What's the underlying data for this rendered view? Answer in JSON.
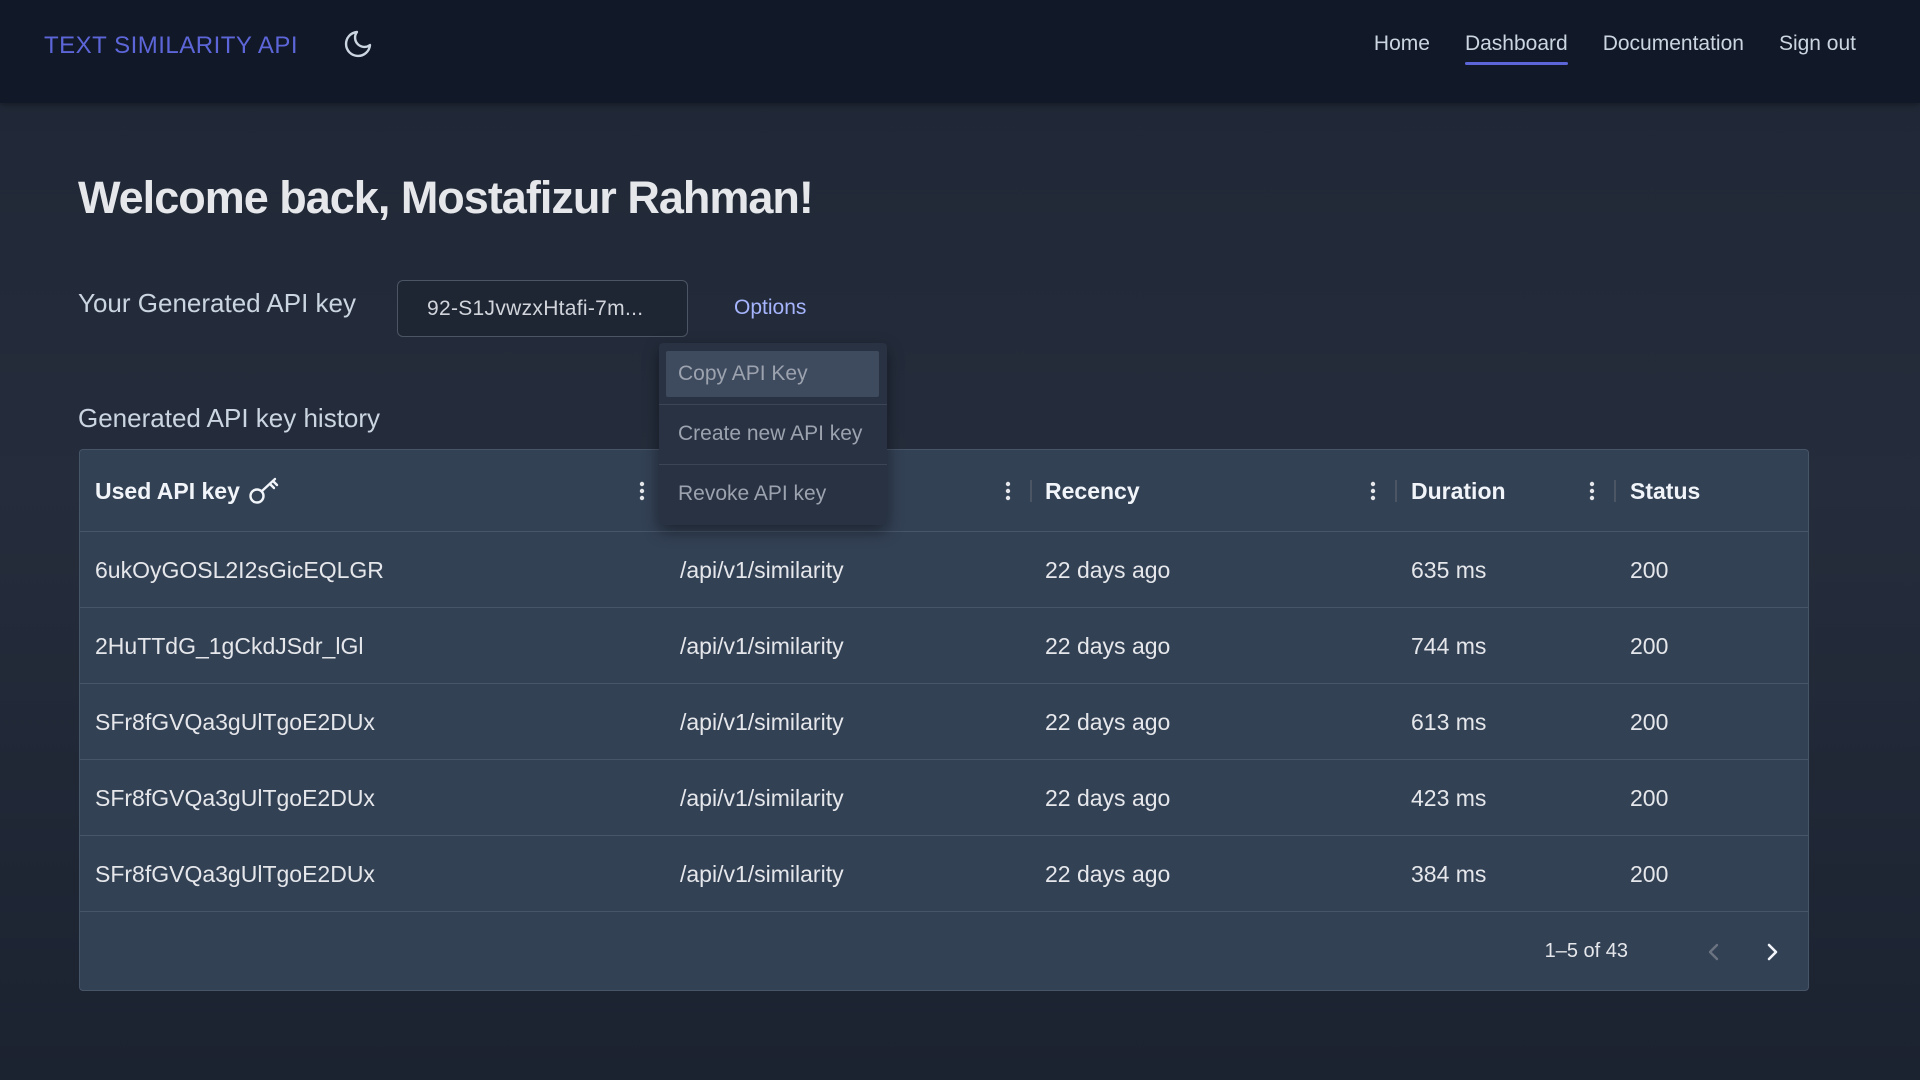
{
  "navbar": {
    "brand": "TEXT SIMILARITY API",
    "theme_icon": "moon-icon",
    "links": [
      {
        "label": "Home",
        "active": false
      },
      {
        "label": "Dashboard",
        "active": true
      },
      {
        "label": "Documentation",
        "active": false
      },
      {
        "label": "Sign out",
        "active": false
      }
    ]
  },
  "main": {
    "welcome": "Welcome back, Mostafizur Rahman!",
    "api_key_label": "Your Generated API key",
    "api_key_value": "92-S1JvwzxHtafi-7m...",
    "options_label": "Options",
    "history_title": "Generated API key history"
  },
  "dropdown": {
    "items": [
      "Copy API Key",
      "Create new API key",
      "Revoke API key"
    ],
    "highlighted": "Copy API Key"
  },
  "table": {
    "columns": [
      {
        "label": "Used API key",
        "icon": "key-icon"
      },
      {
        "label": ""
      },
      {
        "label": "Recency"
      },
      {
        "label": "Duration"
      },
      {
        "label": "Status"
      }
    ],
    "rows": [
      {
        "key": "6ukOyGOSL2I2sGicEQLGR",
        "path": "/api/v1/similarity",
        "recency": "22 days ago",
        "duration": "635 ms",
        "status": "200"
      },
      {
        "key": "2HuTTdG_1gCkdJSdr_lGl",
        "path": "/api/v1/similarity",
        "recency": "22 days ago",
        "duration": "744 ms",
        "status": "200"
      },
      {
        "key": "SFr8fGVQa3gUlTgoE2DUx",
        "path": "/api/v1/similarity",
        "recency": "22 days ago",
        "duration": "613 ms",
        "status": "200"
      },
      {
        "key": "SFr8fGVQa3gUlTgoE2DUx",
        "path": "/api/v1/similarity",
        "recency": "22 days ago",
        "duration": "423 ms",
        "status": "200"
      },
      {
        "key": "SFr8fGVQa3gUlTgoE2DUx",
        "path": "/api/v1/similarity",
        "recency": "22 days ago",
        "duration": "384 ms",
        "status": "200"
      }
    ],
    "pagination": {
      "range": "1–5 of 43",
      "prev_icon": "chevron-left-icon",
      "next_icon": "chevron-right-icon"
    }
  },
  "colors": {
    "accent": "#5d66d8",
    "navbar_bg": "#111827",
    "table_bg": "#334155"
  }
}
